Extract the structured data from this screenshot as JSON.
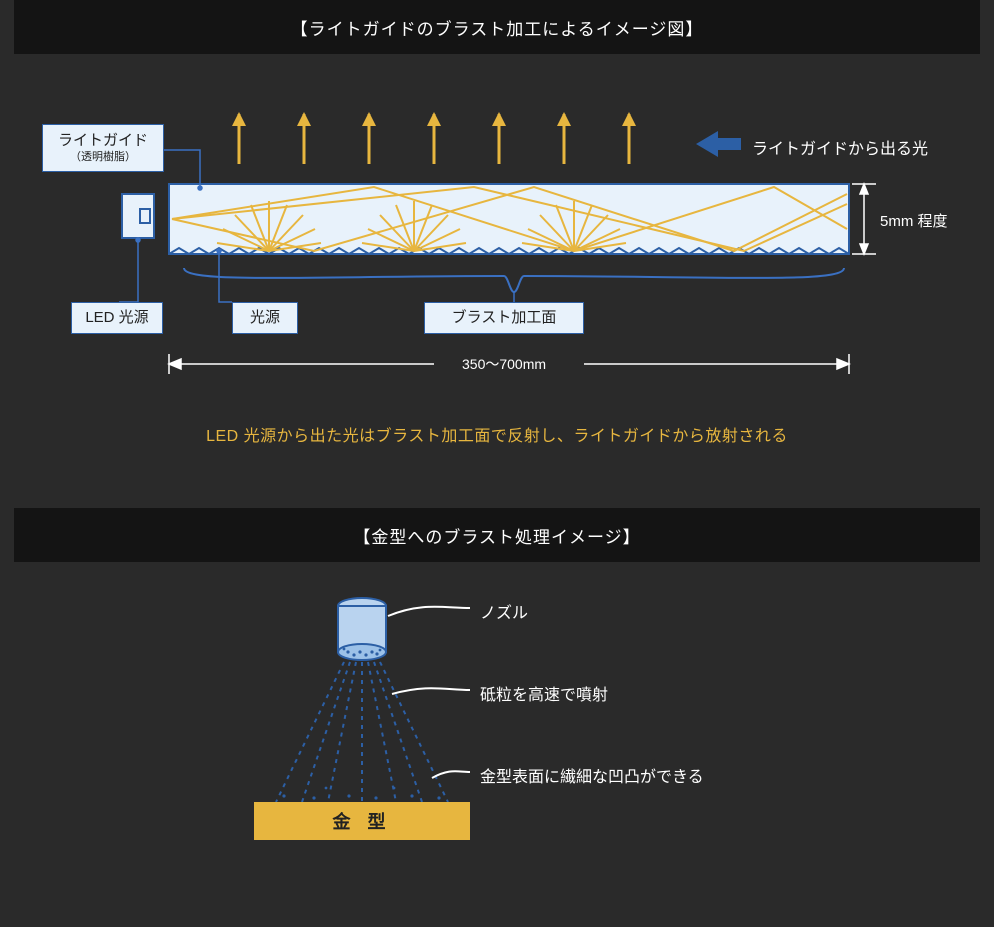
{
  "section1": {
    "title": "【ライトガイドのブラスト加工によるイメージ図】",
    "labels": {
      "lightguide": "ライトガイド",
      "lightguide_sub": "（透明樹脂）",
      "led": "LED 光源",
      "innerlight": "光源",
      "blastsurf": "ブラスト加工面",
      "emitted": "ライトガイドから出る光",
      "thickness": "5mm 程度",
      "width": "350〜700mm"
    },
    "caption": "LED 光源から出た光はブラスト加工面で反射し、ライトガイドから放射される"
  },
  "section2": {
    "title": "【金型へのブラスト処理イメージ】",
    "labels": {
      "nozzle": "ノズル",
      "spray": "砥粒を高速で噴射",
      "surface": "金型表面に繊細な凹凸ができる",
      "mold": "金 型"
    }
  },
  "colors": {
    "gold": "#e7b63f",
    "navy": "#2c5fa5",
    "pale": "#e8f2fb",
    "link": "#3a70c2"
  }
}
